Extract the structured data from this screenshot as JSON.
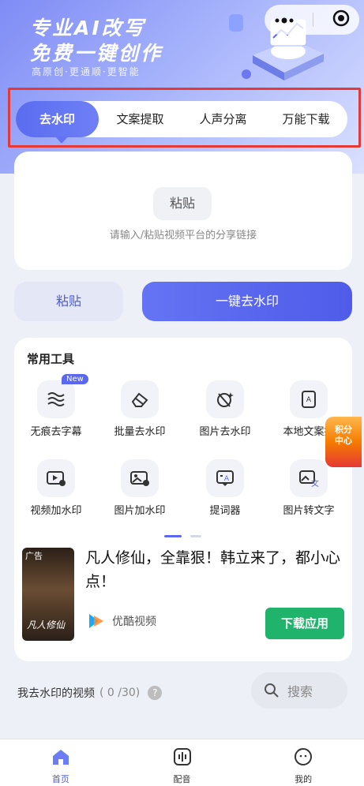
{
  "header": {
    "title_line1": "专业AI改写",
    "title_line2": "免费一键创作",
    "subtitle": "高原创·更通顺·更智能"
  },
  "tabs": [
    {
      "label": "去水印",
      "active": true
    },
    {
      "label": "文案提取",
      "active": false
    },
    {
      "label": "人声分离",
      "active": false
    },
    {
      "label": "万能下载",
      "active": false
    }
  ],
  "paste_area": {
    "chip_label": "粘贴",
    "hint": "请输入/粘贴视频平台的分享链接"
  },
  "actions": {
    "paste_label": "粘贴",
    "go_label": "一键去水印"
  },
  "tools": {
    "title": "常用工具",
    "new_badge": "New",
    "items": [
      {
        "label": "无痕去字幕",
        "icon": "subtitle-wave-icon"
      },
      {
        "label": "批量去水印",
        "icon": "eraser-icon"
      },
      {
        "label": "图片去水印",
        "icon": "image-eraser-icon"
      },
      {
        "label": "本地文案提",
        "icon": "document-text-icon"
      },
      {
        "label": "视频加水印",
        "icon": "video-watermark-icon"
      },
      {
        "label": "图片加水印",
        "icon": "image-watermark-icon"
      },
      {
        "label": "提词器",
        "icon": "teleprompter-icon"
      },
      {
        "label": "图片转文字",
        "icon": "image-to-text-icon"
      }
    ]
  },
  "ad": {
    "tag": "广告",
    "thumb_text": "凡人修仙",
    "title": "凡人修仙，全靠狠！韩立来了，都小心点！",
    "brand": "优酷视频",
    "cta": "下载应用"
  },
  "points_float": {
    "line1": "积分",
    "line2": "中心"
  },
  "my_videos": {
    "label": "我去水印的视频",
    "count": "( 0 /30)",
    "help": "?",
    "search_label": "搜索"
  },
  "bottom_nav": [
    {
      "label": "首页",
      "active": true
    },
    {
      "label": "配音",
      "active": false
    },
    {
      "label": "我的",
      "active": false
    }
  ],
  "colors": {
    "accent": "#5a67f0",
    "highlight_border": "#e53935",
    "cta_green": "#1fb36b"
  }
}
